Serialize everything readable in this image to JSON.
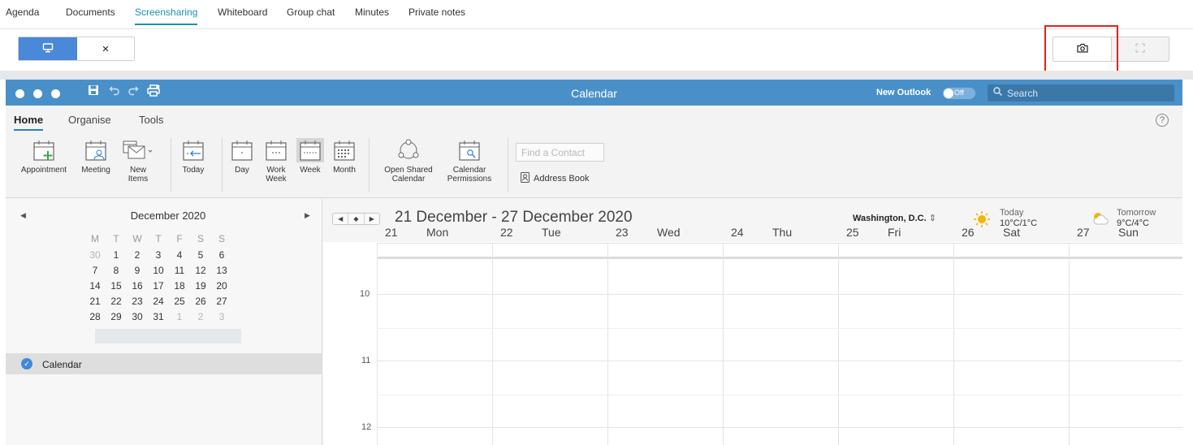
{
  "meeting_tabs": [
    "Agenda",
    "Documents",
    "Screensharing",
    "Whiteboard",
    "Group chat",
    "Minutes",
    "Private notes"
  ],
  "active_meeting_tab": "Screensharing",
  "share_toolbar": {
    "stop_symbol": "×"
  },
  "colors": {
    "accent": "#1e8fb4",
    "share_blue": "#4a88d8",
    "titlebar": "#4a90c8",
    "highlight_box": "#e2231a"
  },
  "window": {
    "title": "Calendar",
    "new_outlook_label": "New Outlook",
    "toggle_state": "Off",
    "search_placeholder": "Search"
  },
  "ribbon": {
    "tabs": [
      "Home",
      "Organise",
      "Tools"
    ],
    "active_tab": "Home",
    "buttons": {
      "appointment": "Appointment",
      "meeting": "Meeting",
      "new_items_1": "New",
      "new_items_2": "Items",
      "today": "Today",
      "day": "Day",
      "work_week_1": "Work",
      "work_week_2": "Week",
      "week": "Week",
      "month": "Month",
      "open_shared_1": "Open Shared",
      "open_shared_2": "Calendar",
      "permissions_1": "Calendar",
      "permissions_2": "Permissions"
    },
    "find_contact_placeholder": "Find a Contact",
    "address_book": "Address Book"
  },
  "mini_calendar": {
    "month_title": "December 2020",
    "weekday_names": [
      "M",
      "T",
      "W",
      "T",
      "F",
      "S",
      "S"
    ],
    "weeks": [
      [
        {
          "d": "30",
          "m": true
        },
        {
          "d": "1"
        },
        {
          "d": "2"
        },
        {
          "d": "3"
        },
        {
          "d": "4"
        },
        {
          "d": "5"
        },
        {
          "d": "6"
        }
      ],
      [
        {
          "d": "7"
        },
        {
          "d": "8"
        },
        {
          "d": "9"
        },
        {
          "d": "10"
        },
        {
          "d": "11"
        },
        {
          "d": "12"
        },
        {
          "d": "13"
        }
      ],
      [
        {
          "d": "14"
        },
        {
          "d": "15"
        },
        {
          "d": "16"
        },
        {
          "d": "17"
        },
        {
          "d": "18"
        },
        {
          "d": "19"
        },
        {
          "d": "20"
        }
      ],
      [
        {
          "d": "21"
        },
        {
          "d": "22"
        },
        {
          "d": "23"
        },
        {
          "d": "24"
        },
        {
          "d": "25"
        },
        {
          "d": "26"
        },
        {
          "d": "27"
        }
      ],
      [
        {
          "d": "28"
        },
        {
          "d": "29"
        },
        {
          "d": "30"
        },
        {
          "d": "31"
        },
        {
          "d": "1",
          "m": true
        },
        {
          "d": "2",
          "m": true
        },
        {
          "d": "3",
          "m": true
        }
      ]
    ],
    "selected_week": 4
  },
  "calendar_list": {
    "item": "Calendar"
  },
  "main_calendar": {
    "range_title": "21 December - 27 December 2020",
    "location": "Washington, D.C.",
    "today_label": "Today",
    "today_temp": "10°C/1°C",
    "tomorrow_label": "Tomorrow",
    "tomorrow_temp": "9°C/4°C",
    "days": [
      {
        "num": "21",
        "name": "Mon"
      },
      {
        "num": "22",
        "name": "Tue"
      },
      {
        "num": "23",
        "name": "Wed"
      },
      {
        "num": "24",
        "name": "Thu"
      },
      {
        "num": "25",
        "name": "Fri"
      },
      {
        "num": "26",
        "name": "Sat"
      },
      {
        "num": "27",
        "name": "Sun"
      }
    ],
    "hours": [
      "10",
      "11",
      "12"
    ]
  }
}
